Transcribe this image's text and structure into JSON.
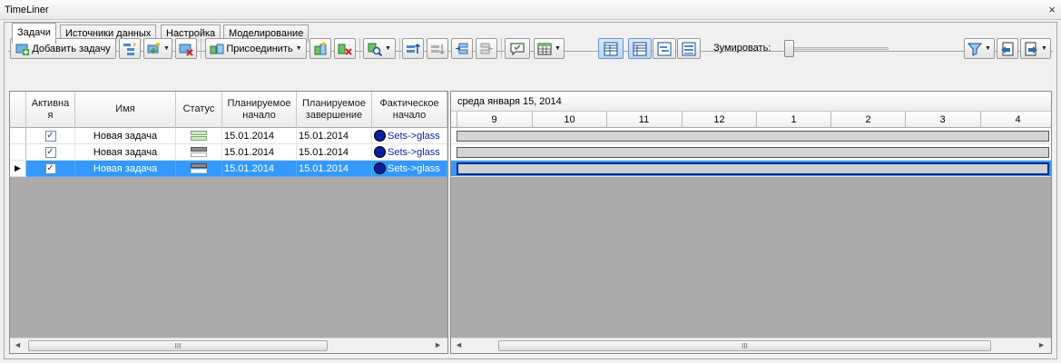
{
  "window": {
    "title": "TimeLiner",
    "close_glyph": "×"
  },
  "tabs": [
    {
      "label": "Задачи",
      "active": true
    },
    {
      "label": "Источники данных",
      "active": false
    },
    {
      "label": "Настройка",
      "active": false
    },
    {
      "label": "Моделирование",
      "active": false
    }
  ],
  "toolbar": {
    "add_task_label": "Добавить задачу",
    "attach_label": "Присоединить",
    "zoom_label": "Зумировать:",
    "zoom_level": 0
  },
  "grid": {
    "headers": {
      "active": "Активна\nя",
      "name": "Имя",
      "status": "Статус",
      "planned_start": "Планируемое\nначало",
      "planned_end": "Планируемое\nзавершение",
      "actual_start": "Фактическое\nначало"
    },
    "rows": [
      {
        "active": "✓",
        "name": "Новая задача",
        "planned_start": "15.01.2014",
        "planned_end": "15.01.2014",
        "actual_start": "Sets->glass",
        "selected": false
      },
      {
        "active": "✓",
        "name": "Новая задача",
        "planned_start": "15.01.2014",
        "planned_end": "15.01.2014",
        "actual_start": "Sets->glass",
        "selected": false
      },
      {
        "active": "✓",
        "name": "Новая задача",
        "planned_start": "15.01.2014",
        "planned_end": "15.01.2014",
        "actual_start": "Sets->glass",
        "selected": true
      }
    ],
    "current_row_glyph": "▶"
  },
  "gantt": {
    "date_label": "среда января 15, 2014",
    "hours": [
      "9",
      "10",
      "11",
      "12",
      "1",
      "2",
      "3",
      "4"
    ]
  },
  "scroll": {
    "left_arrow": "◄",
    "right_arrow": "►",
    "grip": "III"
  },
  "colors": {
    "selection": "#3399ff",
    "grid_background": "#ababab"
  }
}
